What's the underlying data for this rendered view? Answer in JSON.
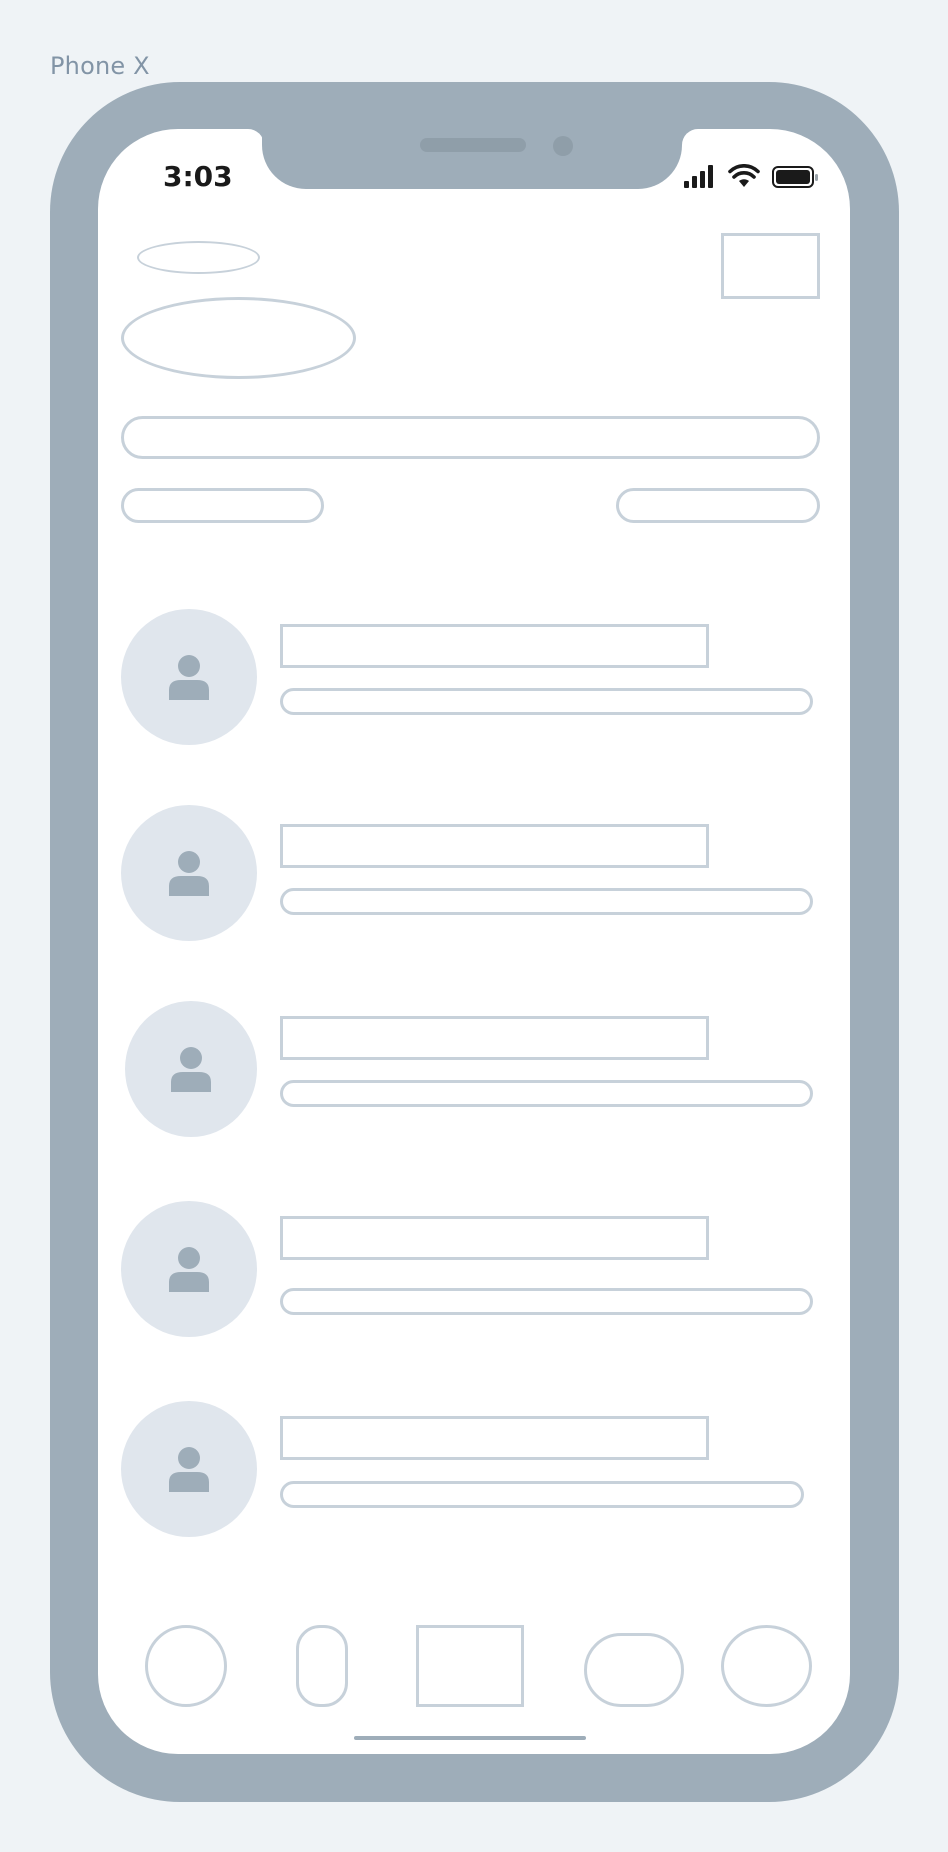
{
  "frame": {
    "label": "Phone X"
  },
  "status_bar": {
    "time": "3:03",
    "icons": [
      "signal-icon",
      "wifi-icon",
      "battery-icon"
    ]
  },
  "colors": {
    "background": "#eff3f6",
    "phone_frame": "#9eadb9",
    "outline": "#c7d1da",
    "avatar_bg": "#e0e6ed",
    "avatar_icon": "#9eadb9"
  },
  "list": {
    "items": [
      {
        "avatar": "user-icon"
      },
      {
        "avatar": "user-icon"
      },
      {
        "avatar": "user-icon"
      },
      {
        "avatar": "user-icon"
      },
      {
        "avatar": "user-icon"
      }
    ]
  },
  "tab_bar": {
    "tabs": [
      "tab-1",
      "tab-2",
      "tab-3",
      "tab-4",
      "tab-5"
    ]
  }
}
